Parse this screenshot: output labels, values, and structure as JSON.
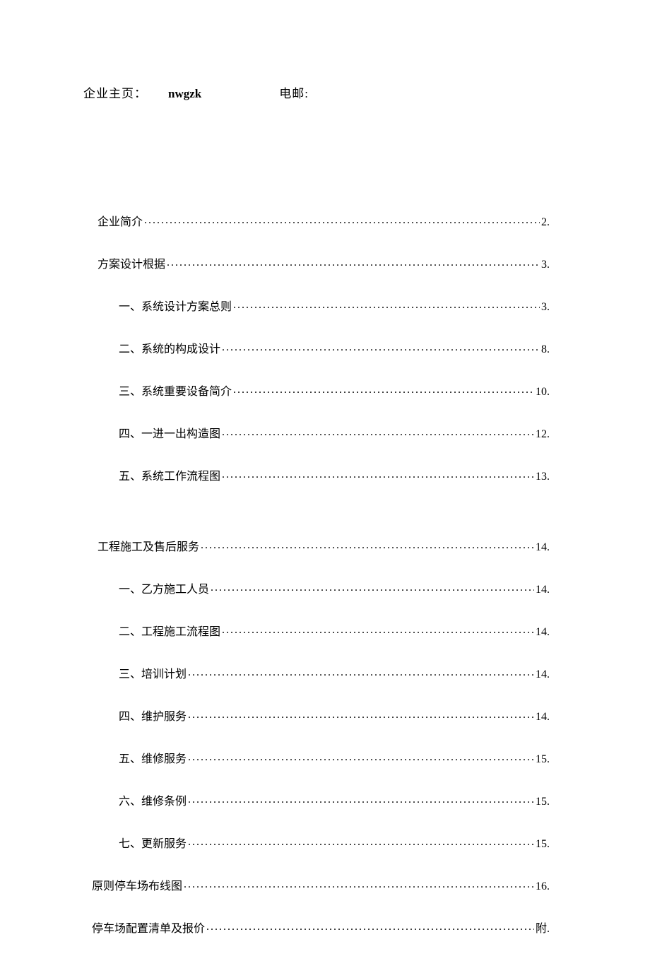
{
  "header": {
    "label1": "企业主页：",
    "value1": "nwgzk",
    "label2": "电邮:"
  },
  "toc": [
    {
      "label": "企业简介",
      "page": "2.",
      "level": 1,
      "spacer": false
    },
    {
      "label": "方案设计根据",
      "page": "3.",
      "level": 1,
      "spacer": false
    },
    {
      "label": "一、系统设计方案总则",
      "page": "3.",
      "level": 2,
      "spacer": false
    },
    {
      "label": "二、系统的构成设计",
      "page": "8.",
      "level": 2,
      "spacer": false
    },
    {
      "label": "三、系统重要设备简介",
      "page": "10.",
      "level": 2,
      "spacer": false
    },
    {
      "label": "四、一进一出构造图",
      "page": "12.",
      "level": 2,
      "spacer": false
    },
    {
      "label": "五、系统工作流程图",
      "page": "13.",
      "level": 2,
      "spacer": true
    },
    {
      "label": "工程施工及售后服务",
      "page": "14.",
      "level": 1,
      "spacer": false
    },
    {
      "label": "一、乙方施工人员",
      "page": "14.",
      "level": 2,
      "spacer": false
    },
    {
      "label": "二、工程施工流程图",
      "page": "14.",
      "level": 2,
      "spacer": false
    },
    {
      "label": "三、培训计划",
      "page": "14.",
      "level": 2,
      "spacer": false
    },
    {
      "label": "四、维护服务",
      "page": "14.",
      "level": 2,
      "spacer": false
    },
    {
      "label": "五、维修服务",
      "page": "15.",
      "level": 2,
      "spacer": false
    },
    {
      "label": "六、维修条例",
      "page": "15.",
      "level": 2,
      "spacer": false
    },
    {
      "label": "七、更新服务",
      "page": "15.",
      "level": 2,
      "spacer": false
    },
    {
      "label": "原则停车场布线图",
      "page": "16.",
      "level": 0,
      "spacer": false
    },
    {
      "label": "停车场配置清单及报价",
      "page": "附.",
      "level": 0,
      "spacer": false
    }
  ]
}
